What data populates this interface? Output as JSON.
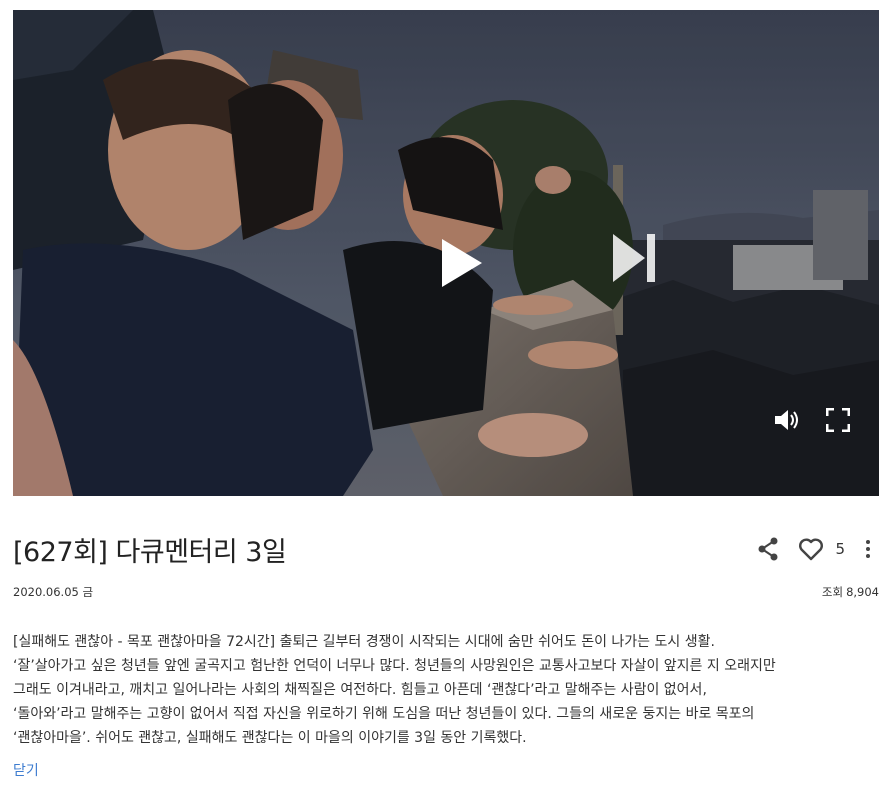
{
  "video": {
    "thumbnail": "Four young women laughing while leaning on a rooftop railing at dusk, overlooking tiled roofs of an old town",
    "controls": {
      "play_icon": "play-icon",
      "next_icon": "skip-next-icon",
      "volume_icon": "volume-icon",
      "fullscreen_icon": "fullscreen-icon"
    }
  },
  "episode": {
    "title": "[627회] 다큐멘터리 3일",
    "date": "2020.06.05 금",
    "views_label": "조회",
    "views_count": "8,904",
    "like_count": "5"
  },
  "description": {
    "lines": [
      "[실패해도 괜찮아 - 목포 괜찮아마을 72시간] 출퇴근 길부터 경쟁이 시작되는 시대에 숨만 쉬어도 돈이 나가는 도시 생활.",
      "‘잘’살아가고 싶은 청년들 앞엔 굴곡지고 험난한 언덕이 너무나 많다. 청년들의 사망원인은 교통사고보다 자살이 앞지른 지 오래지만",
      "그래도 이겨내라고, 깨치고 일어나라는 사회의 채찍질은 여전하다. 힘들고 아픈데 ‘괜찮다’라고 말해주는 사람이 없어서,",
      "‘돌아와’라고 말해주는 고향이 없어서 직접 자신을 위로하기 위해 도심을 떠난 청년들이 있다. 그들의 새로운 둥지는 바로 목포의",
      "‘괜찮아마을’. 쉬어도 괜찮고, 실패해도 괜찮다는 이 마을의 이야기를 3일 동안 기록했다."
    ],
    "close_label": "닫기"
  },
  "colors": {
    "link": "#3d7cd0",
    "text": "#333333"
  }
}
